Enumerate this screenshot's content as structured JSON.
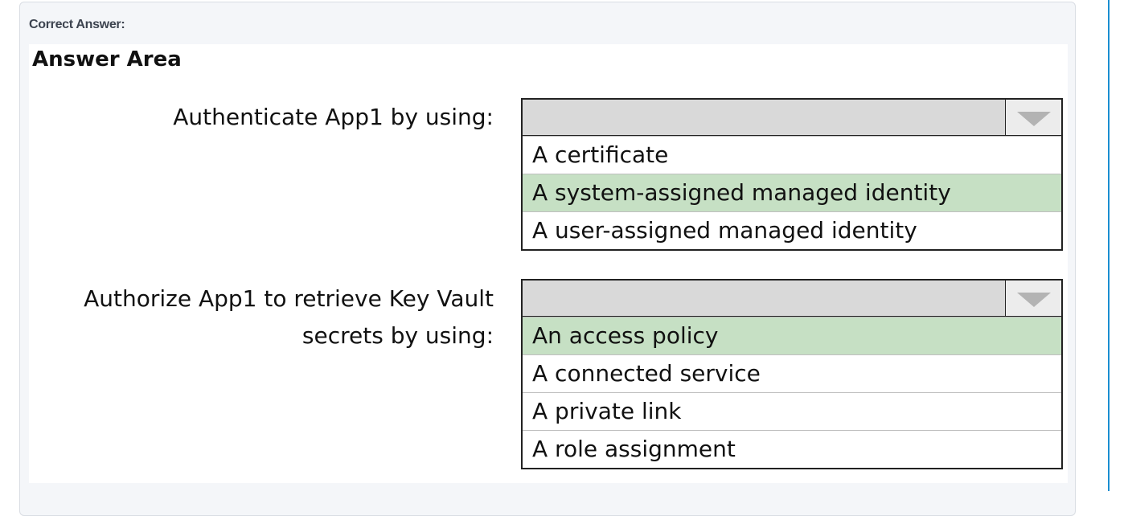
{
  "header": {
    "correct_answer_label": "Correct Answer:"
  },
  "answer_area": {
    "title": "Answer Area",
    "questions": [
      {
        "prompt": "Authenticate App1 by using:",
        "options": [
          "A certificate",
          "A system-assigned managed identity",
          "A user-assigned managed identity"
        ],
        "selected_index": 1
      },
      {
        "prompt_line1": "Authorize App1 to retrieve Key Vault",
        "prompt_line2": "secrets by using:",
        "options": [
          "An access policy",
          "A connected service",
          "A private link",
          "A role assignment"
        ],
        "selected_index": 0
      }
    ]
  },
  "icons": {
    "dropdown": "chevron-down-icon"
  },
  "colors": {
    "selected_option_bg": "#c6e0c4",
    "dropdown_header_bg": "#d9d9d9",
    "accent_rule": "#1a8ed1"
  }
}
